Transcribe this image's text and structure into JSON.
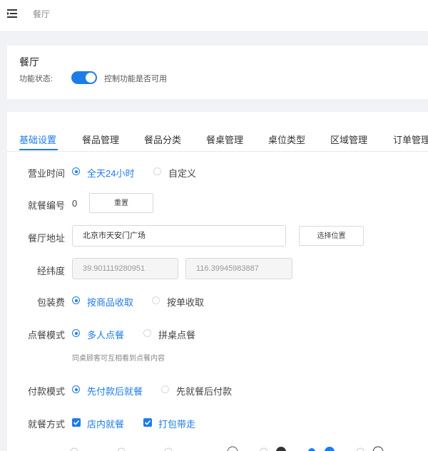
{
  "breadcrumb": "餐厅",
  "header": {
    "title": "餐厅",
    "status_label": "功能状态:",
    "status_enabled": true,
    "status_desc": "控制功能是否可用"
  },
  "tabs": [
    {
      "label": "基础设置",
      "active": true
    },
    {
      "label": "餐品管理",
      "active": false
    },
    {
      "label": "餐品分类",
      "active": false
    },
    {
      "label": "餐桌管理",
      "active": false
    },
    {
      "label": "桌位类型",
      "active": false
    },
    {
      "label": "区域管理",
      "active": false
    },
    {
      "label": "订单管理",
      "active": false
    }
  ],
  "form": {
    "hours": {
      "label": "营业时间",
      "options": [
        "全天24小时",
        "自定义"
      ],
      "selected": 0
    },
    "serial": {
      "label": "就餐编号",
      "value": "0",
      "button": "重置"
    },
    "address": {
      "label": "餐厅地址",
      "value": "北京市天安门广场",
      "button": "选择位置"
    },
    "coords": {
      "label": "经纬度",
      "lat": "39.901119280951",
      "lng": "116.39945983887"
    },
    "packing": {
      "label": "包装费",
      "options": [
        "按商品收取",
        "按单收取"
      ],
      "selected": 0
    },
    "order_mode": {
      "label": "点餐模式",
      "options": [
        "多人点餐",
        "拼桌点餐"
      ],
      "selected": 0,
      "hint": "同桌顾客可互相看到点餐内容"
    },
    "pay_mode": {
      "label": "付款模式",
      "options": [
        "先付款后就餐",
        "先就餐后付款"
      ],
      "selected": 0
    },
    "dine_mode": {
      "label": "就餐方式",
      "options": [
        "店内就餐",
        "打包带走"
      ],
      "checked": [
        true,
        true
      ]
    }
  },
  "colors": {
    "accent": "#1e7ce8"
  }
}
